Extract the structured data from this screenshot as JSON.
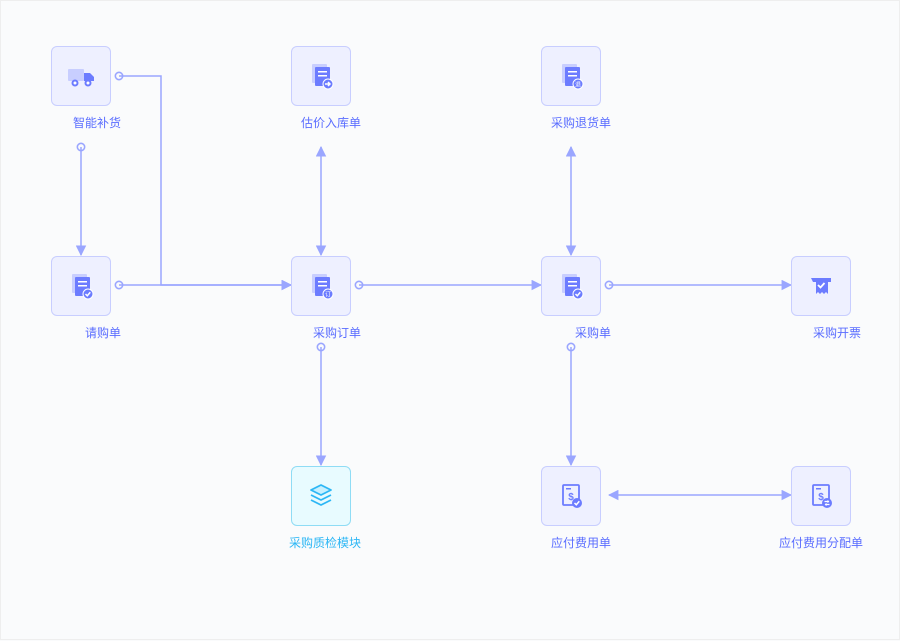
{
  "nodes": {
    "smart_restock": {
      "label": "智能补货",
      "icon": "truck",
      "variant": "blue"
    },
    "estimate_receipt": {
      "label": "估价入库单",
      "icon": "doc-arrow",
      "variant": "blue"
    },
    "purchase_return": {
      "label": "采购退货单",
      "icon": "doc-return",
      "variant": "blue"
    },
    "purchase_request": {
      "label": "请购单",
      "icon": "doc-check",
      "variant": "blue"
    },
    "purchase_order": {
      "label": "采购订单",
      "icon": "doc-order",
      "variant": "blue"
    },
    "purchase_bill": {
      "label": "采购单",
      "icon": "doc-check",
      "variant": "blue"
    },
    "purchase_invoice": {
      "label": "采购开票",
      "icon": "receipt",
      "variant": "blue"
    },
    "qc_module": {
      "label": "采购质检模块",
      "icon": "layers",
      "variant": "cyan"
    },
    "payable_expense": {
      "label": "应付费用单",
      "icon": "doc-money-check",
      "variant": "blue"
    },
    "payable_allocation": {
      "label": "应付费用分配单",
      "icon": "doc-money-swap",
      "variant": "blue"
    }
  },
  "colors": {
    "blue_stroke": "#9aa6ff",
    "blue_fill": "#6c7cff",
    "cyan_fill": "#2db7f5"
  }
}
